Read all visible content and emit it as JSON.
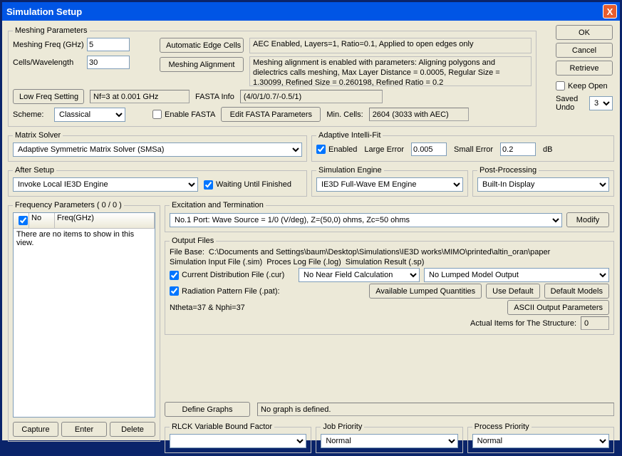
{
  "window": {
    "title": "Simulation Setup",
    "close_glyph": "X"
  },
  "right": {
    "ok": "OK",
    "cancel": "Cancel",
    "retrieve": "Retrieve",
    "keep_open": "Keep Open",
    "saved_undo_label": "Saved Undo",
    "saved_undo_value": "3"
  },
  "meshing": {
    "legend": "Meshing Parameters",
    "freq_label": "Meshing Freq (GHz)",
    "freq_value": "5",
    "cells_label": "Cells/Wavelength",
    "cells_value": "30",
    "auto_edge_btn": "Automatic Edge Cells",
    "mesh_align_btn": "Meshing Alignment",
    "aec_info": "AEC Enabled, Layers=1, Ratio=0.1, Applied to open edges only",
    "align_info": "Meshing alignment is enabled with parameters: Aligning polygons and dielectrics calls meshing, Max Layer Distance = 0.0005, Regular Size = 1.30099, Refined Size = 0.260198, Refined Ratio = 0.2",
    "low_freq_btn": "Low Freq Setting",
    "nf_text": "Nf=3 at 0.001 GHz",
    "fasta_info_label": "FASTA Info",
    "fasta_info_value": "(4/0/1/0.7/-0.5/1)",
    "scheme_label": "Scheme:",
    "scheme_value": "Classical",
    "enable_fasta": "Enable FASTA",
    "edit_fasta_btn": "Edit FASTA Parameters",
    "min_cells_label": "Min. Cells:",
    "min_cells_value": "2604 (3033 with AEC)"
  },
  "matrix_solver": {
    "legend": "Matrix Solver",
    "value": "Adaptive Symmetric Matrix Solver (SMSa)"
  },
  "aif": {
    "legend": "Adaptive Intelli-Fit",
    "enabled": "Enabled",
    "large_error_label": "Large Error",
    "large_error_value": "0.005",
    "small_error_label": "Small Error",
    "small_error_value": "0.2",
    "db": "dB"
  },
  "after_setup": {
    "legend": "After Setup",
    "value": "Invoke Local IE3D Engine",
    "waiting": "Waiting Until Finished"
  },
  "sim_engine": {
    "legend": "Simulation Engine",
    "value": "IE3D Full-Wave EM Engine"
  },
  "post_processing": {
    "legend": "Post-Processing",
    "value": "Built-In Display"
  },
  "freq_params": {
    "legend": "Frequency Parameters ( 0 / 0 )",
    "col_no": "No",
    "col_freq": "Freq(GHz)",
    "empty": "There are no items to show in this view.",
    "capture": "Capture",
    "enter": "Enter",
    "delete": "Delete"
  },
  "excitation": {
    "legend": "Excitation and Termination",
    "value": "No.1 Port: Wave Source = 1/0 (V/deg), Z=(50,0) ohms, Zc=50 ohms",
    "modify": "Modify"
  },
  "output": {
    "legend": "Output Files",
    "file_base_label": "File Base:",
    "file_base_value": "C:\\Documents and Settings\\baum\\Desktop\\Simulations\\IE3D works\\MIMO\\printed\\altin_oran\\paper",
    "sim_in_label": "Simulation Input File (.sim)",
    "proc_log_label": "Proces Log File (.log)",
    "sim_res_label": "Simulation Result (.sp)",
    "cur_dist": "Current Distribution File (.cur)",
    "nearfield_value": "No Near Field Calculation",
    "lumped_value": "No Lumped Model Output",
    "rad_pat": "Radiation Pattern File (.pat):",
    "avail_lumped": "Available Lumped Quantities",
    "use_default": "Use Default",
    "default_models": "Default Models",
    "ntheta": "Ntheta=37 & Nphi=37",
    "ascii_out": "ASCII Output Parameters",
    "actual_items_label": "Actual Items for The Structure:",
    "actual_items_value": "0"
  },
  "graphs": {
    "define": "Define Graphs",
    "none": "No graph is defined."
  },
  "rlck": {
    "legend": "RLCK Variable Bound Factor",
    "value": ""
  },
  "job": {
    "legend": "Job Priority",
    "value": "Normal"
  },
  "proc": {
    "legend": "Process Priority",
    "value": "Normal"
  }
}
